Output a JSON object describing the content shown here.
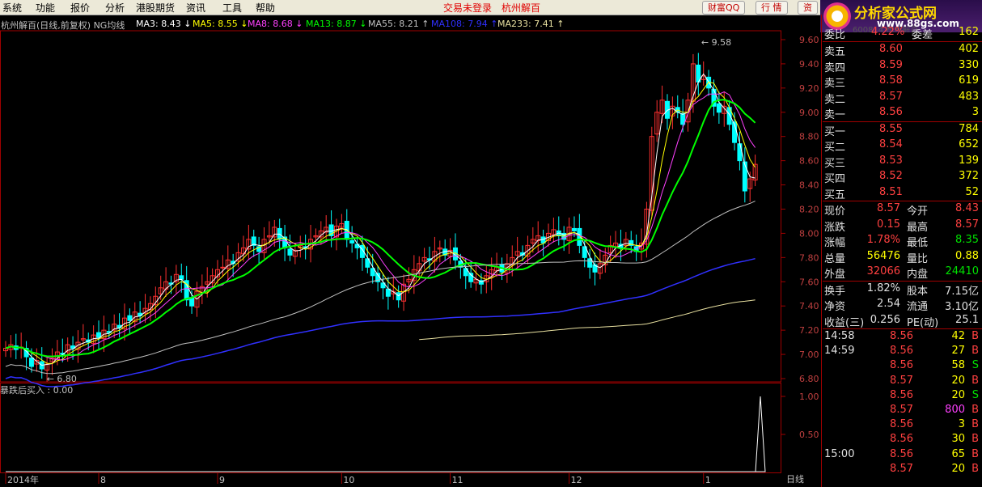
{
  "menu": {
    "items": [
      "系统",
      "功能",
      "报价",
      "分析",
      "港股期货",
      "资讯",
      "工具",
      "帮助"
    ],
    "trade_status": "交易未登录",
    "stock_name": "杭州解百",
    "buttons": [
      "财富QQ",
      "行 情",
      "资"
    ]
  },
  "logo": {
    "title": "分析家公式网",
    "code_hint": "600814 杭州解百",
    "url": "www.88gs.com"
  },
  "chart_header": {
    "title": "杭州解百(日线,前复权) NG均线",
    "mas": [
      {
        "label": "MA3: 8.43",
        "arrow": "↓",
        "color": "#ffffff"
      },
      {
        "label": "MA5: 8.55",
        "arrow": "↓",
        "color": "#ffff00"
      },
      {
        "label": "MA8: 8.68",
        "arrow": "↓",
        "color": "#ff40ff"
      },
      {
        "label": "MA13: 8.87",
        "arrow": "↓",
        "color": "#00ff00"
      },
      {
        "label": "MA55: 8.21",
        "arrow": "↑",
        "color": "#c0c0c0"
      },
      {
        "label": "MA108: 7.94",
        "arrow": "↑",
        "color": "#3030ff"
      },
      {
        "label": "MA233: 7.41",
        "arrow": "↑",
        "color": "#e8e0a0"
      }
    ]
  },
  "colors": {
    "up": "#ff3030",
    "down": "#00ffff",
    "frame": "#a00000",
    "ma3": "#ffffff",
    "ma5": "#ffff00",
    "ma8": "#ff40ff",
    "ma13": "#00ff00",
    "ma55": "#c0c0c0",
    "ma108": "#3030ff",
    "ma233": "#e8e0a0"
  },
  "annotations": {
    "high_label": "9.58",
    "low_label": "6.80"
  },
  "chart_data": {
    "type": "candlestick",
    "title": "杭州解百(日线,前复权) NG均线",
    "ylim": [
      6.8,
      9.66
    ],
    "yticks": [
      "9.60",
      "9.40",
      "9.20",
      "9.00",
      "8.80",
      "8.60",
      "8.40",
      "8.20",
      "8.00",
      "7.80",
      "7.60",
      "7.40",
      "7.20",
      "7.00",
      "6.80"
    ],
    "xticks": [
      {
        "label": "2014年",
        "index": 0
      },
      {
        "label": "8",
        "index": 18
      },
      {
        "label": "9",
        "index": 41
      },
      {
        "label": "10",
        "index": 65
      },
      {
        "label": "11",
        "index": 86
      },
      {
        "label": "12",
        "index": 109
      },
      {
        "label": "1",
        "index": 135
      }
    ],
    "closes": [
      7.05,
      7.08,
      7.04,
      7.06,
      6.98,
      6.9,
      6.95,
      6.88,
      6.92,
      6.97,
      7.02,
      7.0,
      7.08,
      7.05,
      7.1,
      7.13,
      7.1,
      7.16,
      7.14,
      7.2,
      7.18,
      7.25,
      7.22,
      7.3,
      7.28,
      7.35,
      7.32,
      7.38,
      7.42,
      7.48,
      7.55,
      7.6,
      7.58,
      7.66,
      7.62,
      7.45,
      7.4,
      7.52,
      7.56,
      7.6,
      7.65,
      7.7,
      7.72,
      7.78,
      7.75,
      7.84,
      7.88,
      7.95,
      7.9,
      7.85,
      7.95,
      7.98,
      8.05,
      7.95,
      7.88,
      7.82,
      7.86,
      7.9,
      7.88,
      7.95,
      7.98,
      8.02,
      8.05,
      7.98,
      8.06,
      8.08,
      7.95,
      7.92,
      7.88,
      7.8,
      7.72,
      7.65,
      7.6,
      7.55,
      7.48,
      7.52,
      7.45,
      7.58,
      7.62,
      7.7,
      7.75,
      7.8,
      7.78,
      7.85,
      7.88,
      7.82,
      7.86,
      7.78,
      7.72,
      7.65,
      7.6,
      7.62,
      7.58,
      7.65,
      7.7,
      7.72,
      7.68,
      7.75,
      7.8,
      7.85,
      7.82,
      7.9,
      7.95,
      7.98,
      7.92,
      8.0,
      8.03,
      7.98,
      7.95,
      8.05,
      8.02,
      7.9,
      7.8,
      7.72,
      7.68,
      7.75,
      7.82,
      7.9,
      7.92,
      7.88,
      7.95,
      7.9,
      7.85,
      7.92,
      8.2,
      8.8,
      9.0,
      9.1,
      8.95,
      9.05,
      9.0,
      8.9,
      9.1,
      9.4,
      9.25,
      9.3,
      9.2,
      9.05,
      9.0,
      9.05,
      8.9,
      8.75,
      8.6,
      8.35,
      8.45,
      8.57
    ],
    "sub_indicator": {
      "label": "暴跌后买入 : 0.00",
      "yticks": [
        "1.00",
        "0.50"
      ],
      "signal_index": 146,
      "signal_value": 1.0
    }
  },
  "panel": {
    "header": {
      "label": "委比",
      "value": "4.22%",
      "label2": "委差",
      "value2": "162"
    },
    "asks": [
      {
        "label": "卖五",
        "price": "8.60",
        "vol": "402"
      },
      {
        "label": "卖四",
        "price": "8.59",
        "vol": "330"
      },
      {
        "label": "卖三",
        "price": "8.58",
        "vol": "619"
      },
      {
        "label": "卖二",
        "price": "8.57",
        "vol": "483"
      },
      {
        "label": "卖一",
        "price": "8.56",
        "vol": "3"
      }
    ],
    "bids": [
      {
        "label": "买一",
        "price": "8.55",
        "vol": "784"
      },
      {
        "label": "买二",
        "price": "8.54",
        "vol": "652"
      },
      {
        "label": "买三",
        "price": "8.53",
        "vol": "139"
      },
      {
        "label": "买四",
        "price": "8.52",
        "vol": "372"
      },
      {
        "label": "买五",
        "price": "8.51",
        "vol": "52"
      }
    ],
    "stats": [
      {
        "l1": "现价",
        "v1": "8.57",
        "c1": "red",
        "l2": "今开",
        "v2": "8.43",
        "c2": "red"
      },
      {
        "l1": "涨跌",
        "v1": "0.15",
        "c1": "red",
        "l2": "最高",
        "v2": "8.57",
        "c2": "red"
      },
      {
        "l1": "涨幅",
        "v1": "1.78%",
        "c1": "red",
        "l2": "最低",
        "v2": "8.35",
        "c2": "grn"
      },
      {
        "l1": "总量",
        "v1": "56476",
        "c1": "yel",
        "l2": "量比",
        "v2": "0.88",
        "c2": "yel"
      },
      {
        "l1": "外盘",
        "v1": "32066",
        "c1": "red",
        "l2": "内盘",
        "v2": "24410",
        "c2": "grn"
      }
    ],
    "stats2": [
      {
        "l1": "换手",
        "v1": "1.82%",
        "l2": "股本",
        "v2": "7.15亿"
      },
      {
        "l1": "净资",
        "v1": "2.54",
        "l2": "流通",
        "v2": "3.10亿"
      },
      {
        "l1": "收益(三)",
        "v1": "0.256",
        "l2": "PE(动)",
        "v2": "25.1"
      }
    ],
    "ticks": [
      {
        "time": "14:58",
        "price": "8.56",
        "vol": "42",
        "side": "B",
        "vcolor": "yel"
      },
      {
        "time": "14:59",
        "price": "8.56",
        "vol": "27",
        "side": "B",
        "vcolor": "yel"
      },
      {
        "time": "",
        "price": "8.56",
        "vol": "58",
        "side": "S",
        "vcolor": "yel"
      },
      {
        "time": "",
        "price": "8.57",
        "vol": "20",
        "side": "B",
        "vcolor": "yel"
      },
      {
        "time": "",
        "price": "8.56",
        "vol": "20",
        "side": "S",
        "vcolor": "yel"
      },
      {
        "time": "",
        "price": "8.57",
        "vol": "800",
        "side": "B",
        "vcolor": "mag"
      },
      {
        "time": "",
        "price": "8.56",
        "vol": "3",
        "side": "B",
        "vcolor": "yel"
      },
      {
        "time": "",
        "price": "8.56",
        "vol": "30",
        "side": "B",
        "vcolor": "yel"
      },
      {
        "time": "15:00",
        "price": "8.56",
        "vol": "65",
        "side": "B",
        "vcolor": "yel"
      },
      {
        "time": "",
        "price": "8.57",
        "vol": "20",
        "side": "B",
        "vcolor": "yel"
      }
    ]
  },
  "bottom": {
    "period_label": "日线"
  }
}
